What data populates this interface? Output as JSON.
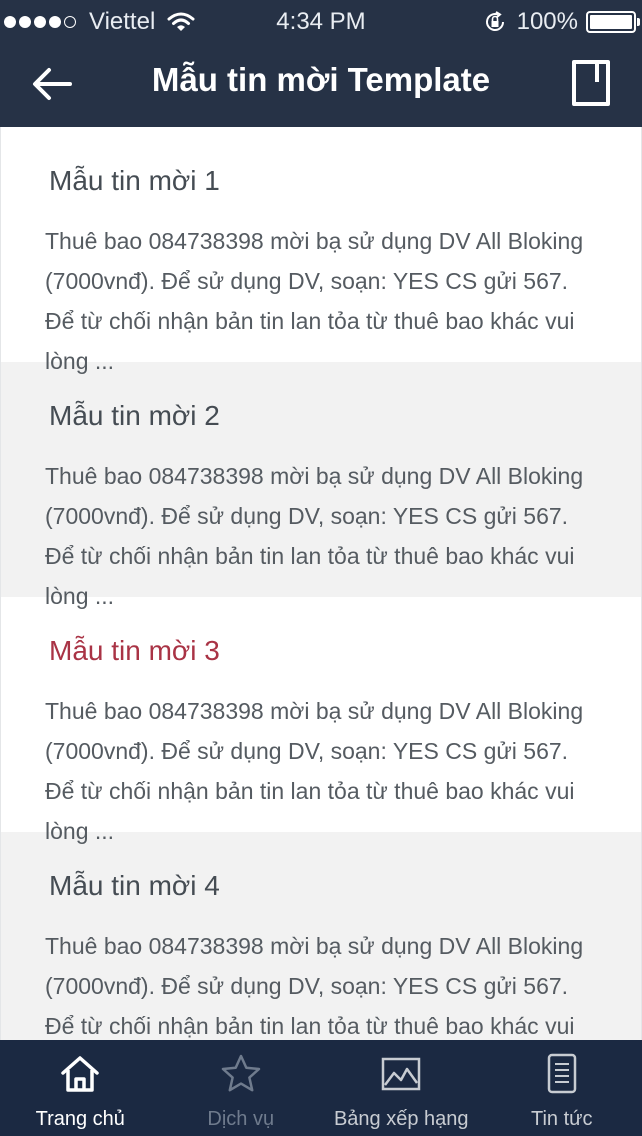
{
  "status_bar": {
    "signal_dots_filled": 4,
    "signal_dots_total": 5,
    "carrier": "Viettel",
    "time": "4:34 PM",
    "battery_level": "100%"
  },
  "navbar": {
    "title": "Mẫu tin mời Template",
    "back_icon": "arrow-left-icon",
    "action_icon": "document-icon"
  },
  "templates": [
    {
      "title": "Mẫu tin mời 1",
      "text": "Thuê bao 084738398 mời bạ sử dụng DV All Bloking (7000vnđ). Để sử dụng DV, soạn: YES CS gửi 567. Để từ chối nhận bản tin lan tỏa từ thuê bao khác vui lòng ..."
    },
    {
      "title": "Mẫu tin mời 2",
      "text": "Thuê bao 084738398 mời bạ sử dụng DV All Bloking (7000vnđ). Để sử dụng DV, soạn: YES CS gửi 567. Để từ chối nhận bản tin lan tỏa từ thuê bao khác vui lòng ..."
    },
    {
      "title": "Mẫu tin mời 3",
      "text": "Thuê bao 084738398 mời bạ sử dụng DV All Bloking (7000vnđ). Để sử dụng DV, soạn: YES CS gửi 567. Để từ chối nhận bản tin lan tỏa từ thuê bao khác vui lòng ..."
    },
    {
      "title": "Mẫu tin mời 4",
      "text": "Thuê bao 084738398 mời bạ sử dụng DV All Bloking (7000vnđ). Để sử dụng DV, soạn: YES CS gửi 567. Để từ chối nhận bản tin lan tỏa từ thuê bao khác vui lòng ..."
    }
  ],
  "tabs": [
    {
      "label": "Trang chủ",
      "icon": "home-icon"
    },
    {
      "label": "Dịch vụ",
      "icon": "star-icon"
    },
    {
      "label": "Bảng xếp hạng",
      "icon": "image-chart-icon"
    },
    {
      "label": "Tin tức",
      "icon": "news-icon"
    }
  ],
  "colors": {
    "header_bg": "#263246",
    "tabbar_bg": "#1b2942",
    "highlight": "#a93345",
    "alt_row_bg": "#f2f2f2"
  }
}
